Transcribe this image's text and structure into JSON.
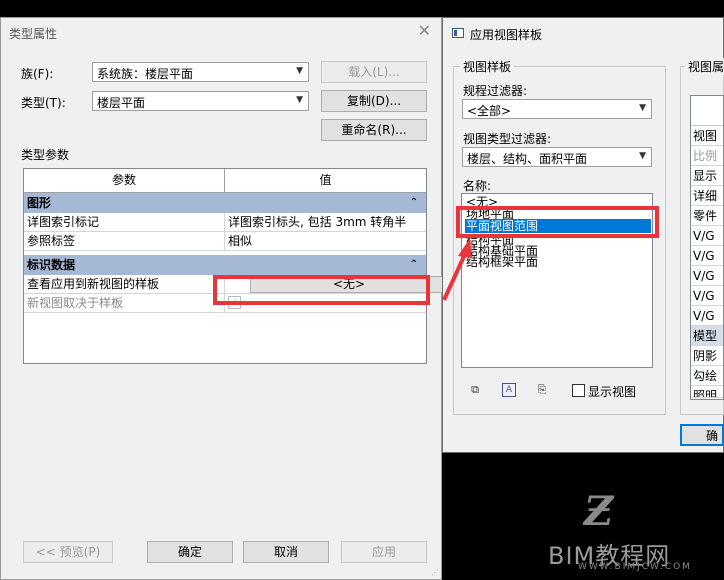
{
  "dialog1": {
    "title": "类型属性",
    "family_label": "族(F):",
    "family_value": "系统族：楼层平面",
    "type_label": "类型(T):",
    "type_value": "楼层平面",
    "load_button": "载入(L)...",
    "duplicate_button": "复制(D)...",
    "rename_button": "重命名(R)...",
    "type_params_label": "类型参数",
    "col_param": "参数",
    "col_value": "值",
    "section_graphics": "图形",
    "row_callout_tag_key": "详图索引标记",
    "row_callout_tag_value": "详图索引标头, 包括 3mm 转角半",
    "row_ref_label_key": "参照标签",
    "row_ref_label_value": "相似",
    "section_identity": "标识数据",
    "row_view_template_key": "查看应用到新视图的样板",
    "row_view_template_value": "<无>",
    "row_new_view_depends_key": "新视图取决于样板",
    "preview_button": "<< 预览(P)",
    "ok_button": "确定",
    "cancel_button": "取消",
    "apply_button": "应用"
  },
  "dialog2": {
    "title": "应用视图样板",
    "group_templates": "视图样板",
    "discipline_filter_label": "规程过滤器:",
    "discipline_filter_value": "<全部>",
    "view_type_filter_label": "视图类型过滤器:",
    "view_type_filter_value": "楼层、结构、面积平面",
    "names_label": "名称:",
    "names": [
      "<无>",
      "场地平面",
      "平面视图范围",
      "结构平面",
      "结构基础平面",
      "结构框架平面"
    ],
    "selected_index": 2,
    "show_views_label": "显示视图",
    "group_properties": "视图属",
    "right_rows": [
      "视图",
      "比例",
      "显示",
      "详细",
      "零件",
      "V/G",
      "V/G",
      "V/G",
      "V/G",
      "V/G",
      "模型",
      "阴影",
      "勾绘",
      "照明"
    ],
    "partial_button": "确"
  },
  "watermark": {
    "brand": "BIM教程网",
    "url": "WWW.BIMJCW.COM"
  },
  "colors": {
    "highlight_box": "#e8353b",
    "selection": "#0078d7",
    "section_band": "#a6b9d4"
  }
}
